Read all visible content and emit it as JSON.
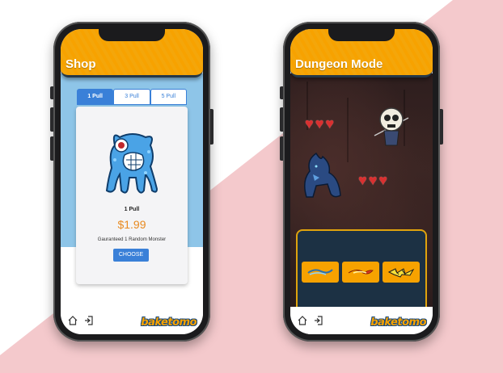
{
  "colors": {
    "background_pink": "#f4c9cc",
    "header_orange": "#f7a200",
    "shop_blue": "#8ec5e8",
    "tab_blue": "#3a80d8",
    "price_orange": "#e88a20",
    "panel_navy": "#1c3144",
    "panel_border": "#e0a30d",
    "heart_red": "#d93030"
  },
  "shop_screen": {
    "header_title": "Shop",
    "tabs": [
      {
        "label": "1 Pull",
        "active": true
      },
      {
        "label": "3 Pull",
        "active": false
      },
      {
        "label": "5 Pull",
        "active": false
      }
    ],
    "card": {
      "pull_name": "1 Pull",
      "price": "$1.99",
      "description": "Gauranteed 1 Random Monster",
      "choose_label": "CHOOSE"
    },
    "bottom_icons": [
      "home-icon",
      "logout-icon"
    ],
    "logo": "baketomo"
  },
  "dungeon_screen": {
    "header_title": "Dungeon Mode",
    "enemy_hearts": 3,
    "player_hearts": 3,
    "attack_buttons": [
      "attack-wind-icon",
      "attack-fire-icon",
      "attack-lightning-icon"
    ],
    "bottom_icons": [
      "home-icon",
      "logout-icon"
    ],
    "logo": "baketomo"
  }
}
